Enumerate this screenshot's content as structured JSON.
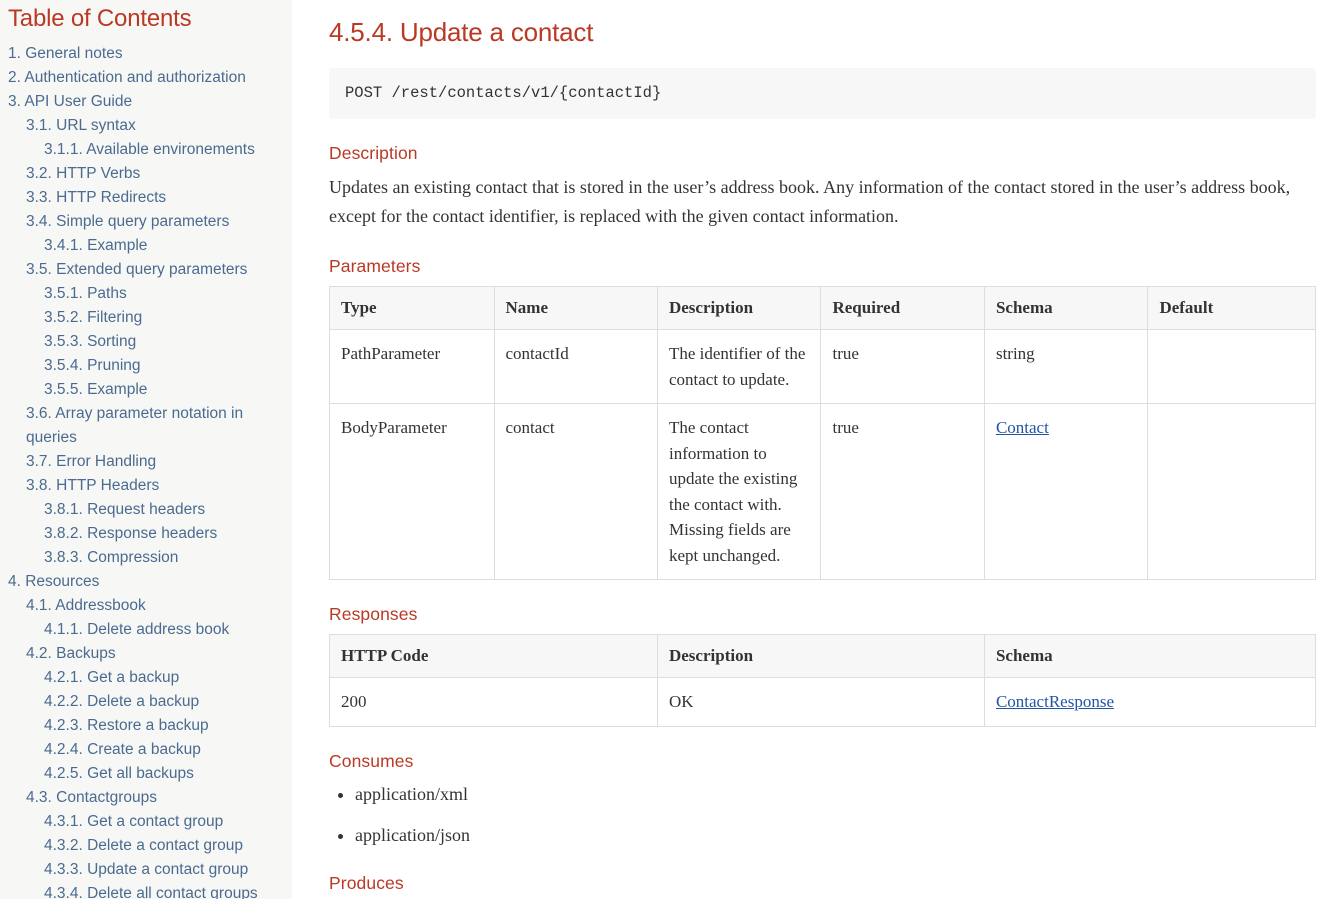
{
  "toc": {
    "title": "Table of Contents",
    "items": [
      {
        "label": "1. General notes",
        "level": 1
      },
      {
        "label": "2. Authentication and authorization",
        "level": 1
      },
      {
        "label": "3. API User Guide",
        "level": 1
      },
      {
        "label": "3.1. URL syntax",
        "level": 2
      },
      {
        "label": "3.1.1. Available environements",
        "level": 3
      },
      {
        "label": "3.2. HTTP Verbs",
        "level": 2
      },
      {
        "label": "3.3. HTTP Redirects",
        "level": 2
      },
      {
        "label": "3.4. Simple query parameters",
        "level": 2
      },
      {
        "label": "3.4.1. Example",
        "level": 3
      },
      {
        "label": "3.5. Extended query parameters",
        "level": 2
      },
      {
        "label": "3.5.1. Paths",
        "level": 3
      },
      {
        "label": "3.5.2. Filtering",
        "level": 3
      },
      {
        "label": "3.5.3. Sorting",
        "level": 3
      },
      {
        "label": "3.5.4. Pruning",
        "level": 3
      },
      {
        "label": "3.5.5. Example",
        "level": 3
      },
      {
        "label": "3.6. Array parameter notation in queries",
        "level": 2
      },
      {
        "label": "3.7. Error Handling",
        "level": 2
      },
      {
        "label": "3.8. HTTP Headers",
        "level": 2
      },
      {
        "label": "3.8.1. Request headers",
        "level": 3
      },
      {
        "label": "3.8.2. Response headers",
        "level": 3
      },
      {
        "label": "3.8.3. Compression",
        "level": 3
      },
      {
        "label": "4. Resources",
        "level": 1
      },
      {
        "label": "4.1. Addressbook",
        "level": 2
      },
      {
        "label": "4.1.1. Delete address book",
        "level": 3
      },
      {
        "label": "4.2. Backups",
        "level": 2
      },
      {
        "label": "4.2.1. Get a backup",
        "level": 3
      },
      {
        "label": "4.2.2. Delete a backup",
        "level": 3
      },
      {
        "label": "4.2.3. Restore a backup",
        "level": 3
      },
      {
        "label": "4.2.4. Create a backup",
        "level": 3
      },
      {
        "label": "4.2.5. Get all backups",
        "level": 3
      },
      {
        "label": "4.3. Contactgroups",
        "level": 2
      },
      {
        "label": "4.3.1. Get a contact group",
        "level": 3
      },
      {
        "label": "4.3.2. Delete a contact group",
        "level": 3
      },
      {
        "label": "4.3.3. Update a contact group",
        "level": 3
      },
      {
        "label": "4.3.4. Delete all contact groups",
        "level": 3
      }
    ]
  },
  "main": {
    "title": "4.5.4. Update a contact",
    "endpoint": "POST /rest/contacts/v1/{contactId}",
    "description_heading": "Description",
    "description_text": "Updates an existing contact that is stored in the user’s address book. Any information of the contact stored in the user’s address book, except for the contact identifier, is replaced with the given contact information.",
    "parameters_heading": "Parameters",
    "parameters_table": {
      "columns": [
        "Type",
        "Name",
        "Description",
        "Required",
        "Schema",
        "Default"
      ],
      "rows": [
        {
          "type": "PathParameter",
          "name": "contactId",
          "description": "The identifier of the contact to update.",
          "required": "true",
          "schema": "string",
          "schema_is_link": false,
          "default": ""
        },
        {
          "type": "BodyParameter",
          "name": "contact",
          "description": "The contact information to update the existing the contact with. Missing fields are kept unchanged.",
          "required": "true",
          "schema": "Contact",
          "schema_is_link": true,
          "default": ""
        }
      ]
    },
    "responses_heading": "Responses",
    "responses_table": {
      "columns": [
        "HTTP Code",
        "Description",
        "Schema"
      ],
      "rows": [
        {
          "code": "200",
          "description": "OK",
          "schema": "ContactResponse",
          "schema_is_link": true
        }
      ]
    },
    "consumes_heading": "Consumes",
    "consumes": [
      "application/xml",
      "application/json"
    ],
    "produces_heading": "Produces"
  },
  "colors": {
    "heading_red": "#ba3925",
    "link_blue": "#2156a5",
    "toc_link": "#4a6b8f",
    "body_text": "#333333",
    "table_border": "#dddddd",
    "code_bg": "#f7f7f7",
    "sidebar_bg": "#f7f7f6",
    "scrollbar_thumb": "#bcbcbc",
    "scrollbar_track": "#efefef"
  }
}
